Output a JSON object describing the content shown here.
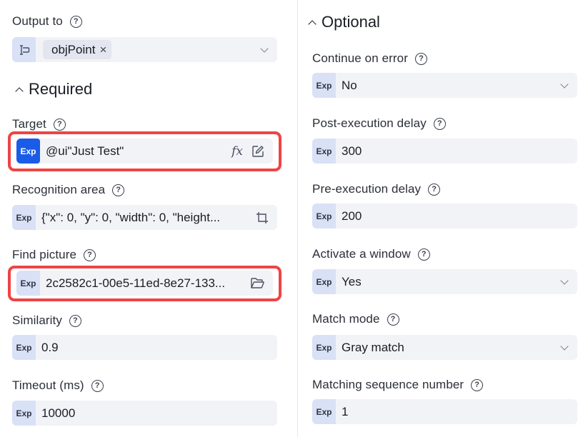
{
  "output": {
    "label": "Output to",
    "variable_tag": "objPoint",
    "tag_remove_glyph": "×"
  },
  "sections": {
    "required": "Required",
    "optional": "Optional"
  },
  "exp_badge": "Exp",
  "help_glyph": "?",
  "required_fields": {
    "target": {
      "label": "Target",
      "value": "@ui\"Just Test\"",
      "highlighted": true
    },
    "recognition_area": {
      "label": "Recognition area",
      "value": "{\"x\": 0, \"y\": 0, \"width\": 0, \"height..."
    },
    "find_picture": {
      "label": "Find picture",
      "value": "2c2582c1-00e5-11ed-8e27-133...",
      "highlighted": true
    },
    "similarity": {
      "label": "Similarity",
      "value": "0.9"
    },
    "timeout": {
      "label": "Timeout (ms)",
      "value": "10000"
    }
  },
  "optional_fields": {
    "continue_on_error": {
      "label": "Continue on error",
      "value": "No"
    },
    "post_delay": {
      "label": "Post-execution delay",
      "value": "300"
    },
    "pre_delay": {
      "label": "Pre-execution delay",
      "value": "200"
    },
    "activate_window": {
      "label": "Activate a window",
      "value": "Yes"
    },
    "match_mode": {
      "label": "Match mode",
      "value": "Gray match"
    },
    "sequence_number": {
      "label": "Matching sequence number",
      "value": "1"
    }
  },
  "colors": {
    "accent": "#1a5ce8",
    "highlight_border": "#ee4444",
    "field_bg": "#f2f3f7",
    "exp_bg": "#d9e1f6"
  }
}
